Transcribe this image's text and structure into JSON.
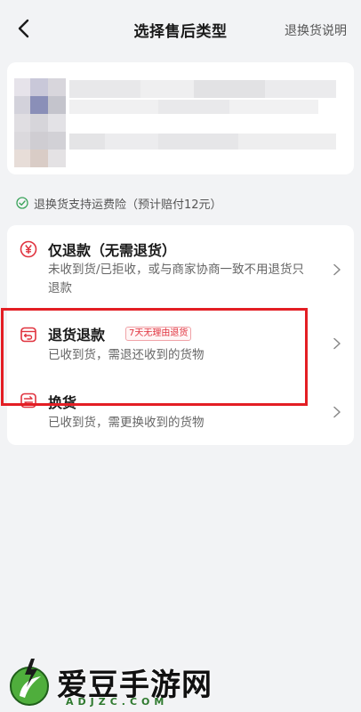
{
  "header": {
    "title": "选择售后类型",
    "help_link": "退换货说明"
  },
  "insurance_note": "退换货支持运费险（预计赔付12元）",
  "options": [
    {
      "title": "仅退款（无需退货）",
      "desc": "未收到货/已拒收，或与商家协商一致不用退货只退款",
      "icon": "yen-icon"
    },
    {
      "title": "退货退款",
      "badge": "7天无理由退货",
      "desc": "已收到货，需退还收到的货物",
      "icon": "return-box-icon"
    },
    {
      "title": "换货",
      "desc": "已收到货，需更换收到的货物",
      "icon": "exchange-icon"
    }
  ],
  "colors": {
    "accent_red": "#e0333f",
    "highlight_red": "#e31e24",
    "check_green": "#3aa35a"
  },
  "watermark": {
    "text": "爱豆手游网",
    "url": "ADJZC.COM"
  }
}
